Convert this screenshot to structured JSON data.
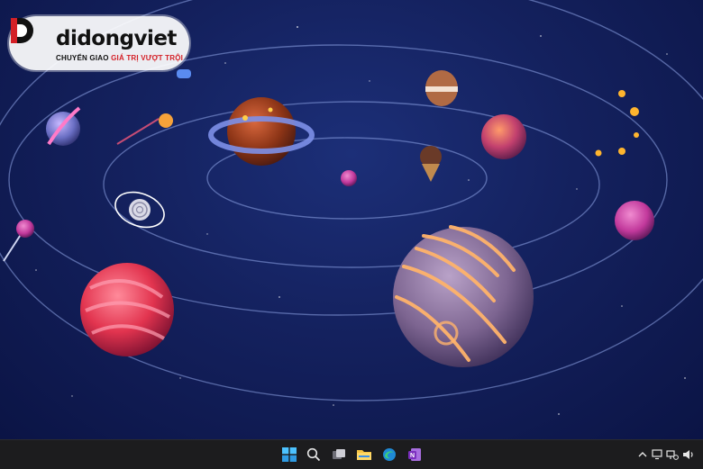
{
  "brand": {
    "name": "didongviet",
    "tagline_prefix": "CHUYỂN GIAO",
    "tagline_accent": "GIÁ TRỊ VƯỢT TRỘI"
  },
  "wallpaper": {
    "theme": "candy planets in outer space",
    "colors": {
      "space": "#14215e",
      "orbit": "#8fa6e8",
      "glow": "#ffb36b"
    }
  },
  "taskbar": {
    "items": [
      {
        "icon": "windows-start-icon"
      },
      {
        "icon": "search-icon"
      },
      {
        "icon": "task-view-icon"
      },
      {
        "icon": "file-explorer-icon"
      },
      {
        "icon": "edge-browser-icon"
      },
      {
        "icon": "onenote-icon"
      }
    ],
    "tray": [
      {
        "icon": "chevron-up-icon"
      },
      {
        "icon": "display-icon"
      },
      {
        "icon": "network-icon"
      },
      {
        "icon": "volume-icon"
      }
    ]
  }
}
